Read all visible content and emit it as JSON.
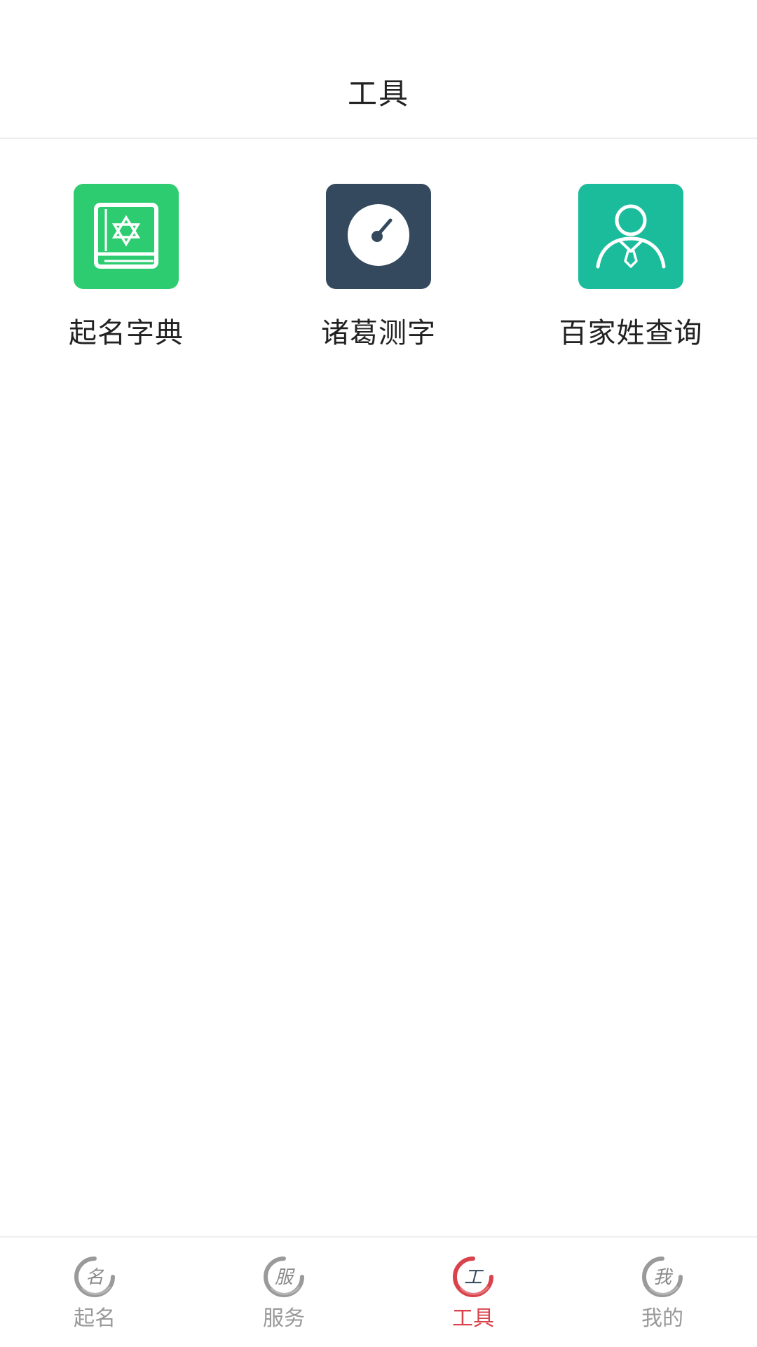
{
  "header": {
    "title": "工具"
  },
  "tools": [
    {
      "label": "起名字典",
      "icon": "book-star-icon",
      "color": "#2ecc71"
    },
    {
      "label": "诸葛测字",
      "icon": "compass-dial-icon",
      "color": "#34495e"
    },
    {
      "label": "百家姓查询",
      "icon": "person-icon",
      "color": "#1abc9c"
    }
  ],
  "tabbar": {
    "items": [
      {
        "label": "起名",
        "glyph": "名",
        "icon": "brush-circle-icon",
        "active": false
      },
      {
        "label": "服务",
        "glyph": "服",
        "icon": "brush-circle-icon",
        "active": false
      },
      {
        "label": "工具",
        "glyph": "工",
        "icon": "brush-circle-icon",
        "active": true
      },
      {
        "label": "我的",
        "glyph": "我",
        "icon": "brush-circle-icon",
        "active": false
      }
    ],
    "active_color": "#d9424a",
    "inactive_color": "#999999"
  }
}
